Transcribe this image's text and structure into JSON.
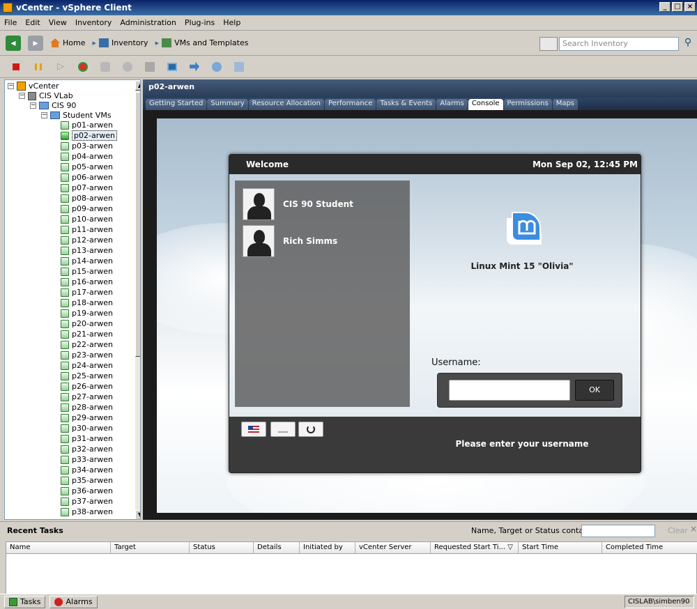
{
  "window": {
    "title": "vCenter - vSphere Client",
    "buttons": [
      "_",
      "□",
      "×"
    ]
  },
  "menu": [
    "File",
    "Edit",
    "View",
    "Inventory",
    "Administration",
    "Plug-ins",
    "Help"
  ],
  "nav": {
    "crumbs": [
      "Home",
      "Inventory",
      "VMs and Templates"
    ],
    "search_placeholder": "Search Inventory"
  },
  "tree": {
    "root": "vCenter",
    "datacenter": "CIS VLab",
    "folder": "CIS 90",
    "subfolder": "Student VMs",
    "vms": [
      "p01-arwen",
      "p02-arwen",
      "p03-arwen",
      "p04-arwen",
      "p05-arwen",
      "p06-arwen",
      "p07-arwen",
      "p08-arwen",
      "p09-arwen",
      "p10-arwen",
      "p11-arwen",
      "p12-arwen",
      "p13-arwen",
      "p14-arwen",
      "p15-arwen",
      "p16-arwen",
      "p17-arwen",
      "p18-arwen",
      "p19-arwen",
      "p20-arwen",
      "p21-arwen",
      "p22-arwen",
      "p23-arwen",
      "p24-arwen",
      "p25-arwen",
      "p26-arwen",
      "p27-arwen",
      "p28-arwen",
      "p29-arwen",
      "p30-arwen",
      "p31-arwen",
      "p32-arwen",
      "p33-arwen",
      "p34-arwen",
      "p35-arwen",
      "p36-arwen",
      "p37-arwen",
      "p38-arwen"
    ],
    "selected": "p02-arwen"
  },
  "vm": {
    "title": "p02-arwen",
    "tabs": [
      "Getting Started",
      "Summary",
      "Resource Allocation",
      "Performance",
      "Tasks & Events",
      "Alarms",
      "Console",
      "Permissions",
      "Maps"
    ],
    "active_tab": "Console"
  },
  "login": {
    "header_left": "Welcome",
    "header_right": "Mon Sep 02, 12:45 PM",
    "users": [
      "CIS 90 Student",
      "Rich Simms"
    ],
    "os_name": "Linux Mint 15 \"Olivia\"",
    "username_label": "Username:",
    "username_value": "",
    "ok": "OK",
    "prompt": "Please enter your username"
  },
  "recent_tasks": {
    "title": "Recent Tasks",
    "filter_label": "Name, Target or Status contains: ▾",
    "filter_value": "",
    "clear": "Clear",
    "close": "×",
    "columns": [
      "Name",
      "Target",
      "Status",
      "Details",
      "Initiated by",
      "vCenter Server",
      "Requested Start Ti... ▽",
      "Start Time",
      "Completed Time"
    ]
  },
  "status": {
    "tasks": "Tasks",
    "alarms": "Alarms",
    "user": "CISLAB\\simben90"
  },
  "colors": {
    "titlebar": "#0a246a",
    "panel": "#d4d0c8",
    "vm_header": "#2a3c58"
  }
}
